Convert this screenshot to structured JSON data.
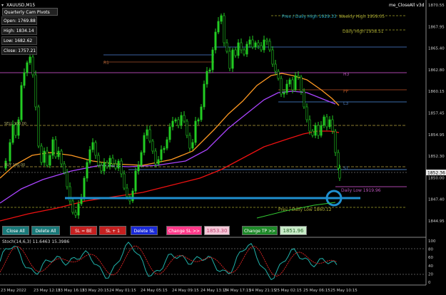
{
  "header": {
    "symbol": "XAUUSD,M15",
    "indicator_label": "Quarterly Cam Pivots Charts",
    "ea_label": "me_CloseAll v3d"
  },
  "info_panel": {
    "open": "Open: 1769.88",
    "high": "High: 1834.14",
    "low": "Low: 1682.62",
    "close": "Close: 1757.21"
  },
  "price_axis": [
    "1870.55",
    "1867.95",
    "1865.40",
    "1862.80",
    "1860.15",
    "1857.45",
    "1854.95",
    "1852.30",
    "1850.00",
    "1847.40",
    "1844.95"
  ],
  "current_price": "1852.36",
  "level_labels": {
    "prev_daily_high": "Prev / Daily High 1929.33",
    "weekly_high": "Weekly High 1959.05",
    "daily_high": "Daily High 1938.51",
    "h3": "H3",
    "pp": "PP",
    "l3": "L3",
    "s1": "S1",
    "r1": "R1",
    "daily_low": "Daily Low 1919.96",
    "prev_daily_low": "Prev / Daily Low 1860.12",
    "sell_limit": "SELL 100.00",
    "buy_limit": "BUY 100.00"
  },
  "buttons": {
    "close_all": "Close All",
    "delete_all": "Delete All",
    "sl_be": "SL = BE",
    "sl_plus": "SL + 1",
    "delete_sl": "Delete SL",
    "change_sl": "Change SL >>",
    "change_sl_value": "1853.30",
    "change_tp": "Change TP >>",
    "change_tp_value": "1851.96"
  },
  "stoch": {
    "label": "Stoch(14,6,3) 11.6463 15.3986",
    "axis": [
      "100",
      "80",
      "60",
      "40",
      "20",
      "0"
    ]
  },
  "time_axis": [
    "23 May 2022",
    "23 May 12:15",
    "23 May 16:15",
    "23 May 20:15",
    "24 May 01:15",
    "24 May 05:15",
    "24 May 09:15",
    "24 May 13:15",
    "24 May 17:15",
    "24 May 21:15",
    "25 May 02:15",
    "25 May 06:15",
    "25 May 10:15"
  ],
  "colors": {
    "bull_candle": "#22cc22",
    "ma_orange": "#ff9922",
    "ma_violet": "#aa44ff",
    "ma_red": "#ee1111",
    "trendline": "#1f8fd0",
    "grid": "#2a2a2a"
  }
}
